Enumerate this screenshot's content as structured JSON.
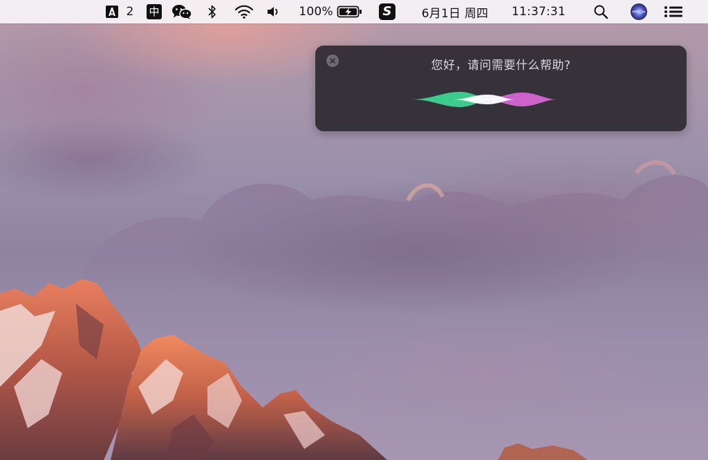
{
  "menubar": {
    "adobe_badge": "2",
    "input_method": "中",
    "battery_percent": "100%",
    "sogou_label": "S",
    "date": "6月1日 周四",
    "time": "11:37:31",
    "icons": {
      "adobe": "adobe-creative-cloud-icon",
      "input": "input-method-icon",
      "wechat": "wechat-icon",
      "bluetooth": "bluetooth-icon",
      "wifi": "wifi-icon",
      "volume": "volume-icon",
      "battery": "battery-charging-icon",
      "sogou": "sogou-input-icon",
      "spotlight": "search-icon",
      "siri": "siri-icon",
      "notification": "notification-center-icon"
    }
  },
  "siri": {
    "prompt": "您好，请问需要什么帮助?",
    "close_icon": "close-icon",
    "waveform_colors": [
      "#3ddc97",
      "#ffffff",
      "#e86be8"
    ]
  },
  "desktop": {
    "wallpaper": "macOS Sierra mountain sunset"
  }
}
